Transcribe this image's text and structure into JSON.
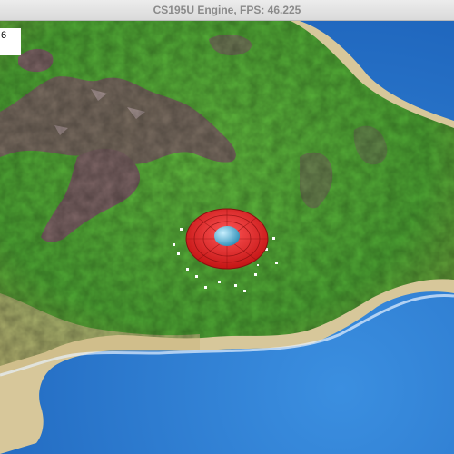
{
  "window": {
    "title": "CS195U Engine, FPS: 46.225"
  },
  "hud": {
    "counter_text": "6"
  },
  "colors": {
    "ocean": "#2d7fd0",
    "sand": "#d7c79a",
    "grass": "#5bb33a",
    "rock": "#7a6463",
    "saucer": "#e22a2a",
    "dome": "#6ac7e8"
  }
}
